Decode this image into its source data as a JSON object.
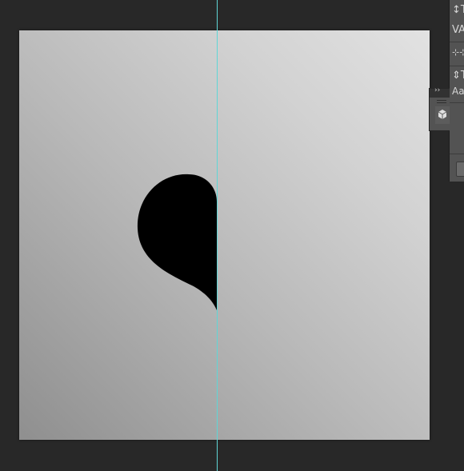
{
  "canvas": {
    "gradient_start": "#8f8f8f",
    "gradient_end": "#e2e2e2",
    "shape_color": "#000000"
  },
  "guide": {
    "orientation": "vertical",
    "color": "#5fd6d6"
  },
  "panel_strip": {
    "glyphs": [
      {
        "icon": "leading-icon",
        "text": "↕T"
      },
      {
        "icon": "tracking-icon",
        "text": "VA"
      },
      {
        "icon": "scale-icon",
        "text": "⇕T"
      },
      {
        "icon": "baseline-shift-icon",
        "text": "Aa"
      }
    ]
  },
  "dock": {
    "collapse_glyph": "››",
    "icon": "3d-cube-icon"
  }
}
